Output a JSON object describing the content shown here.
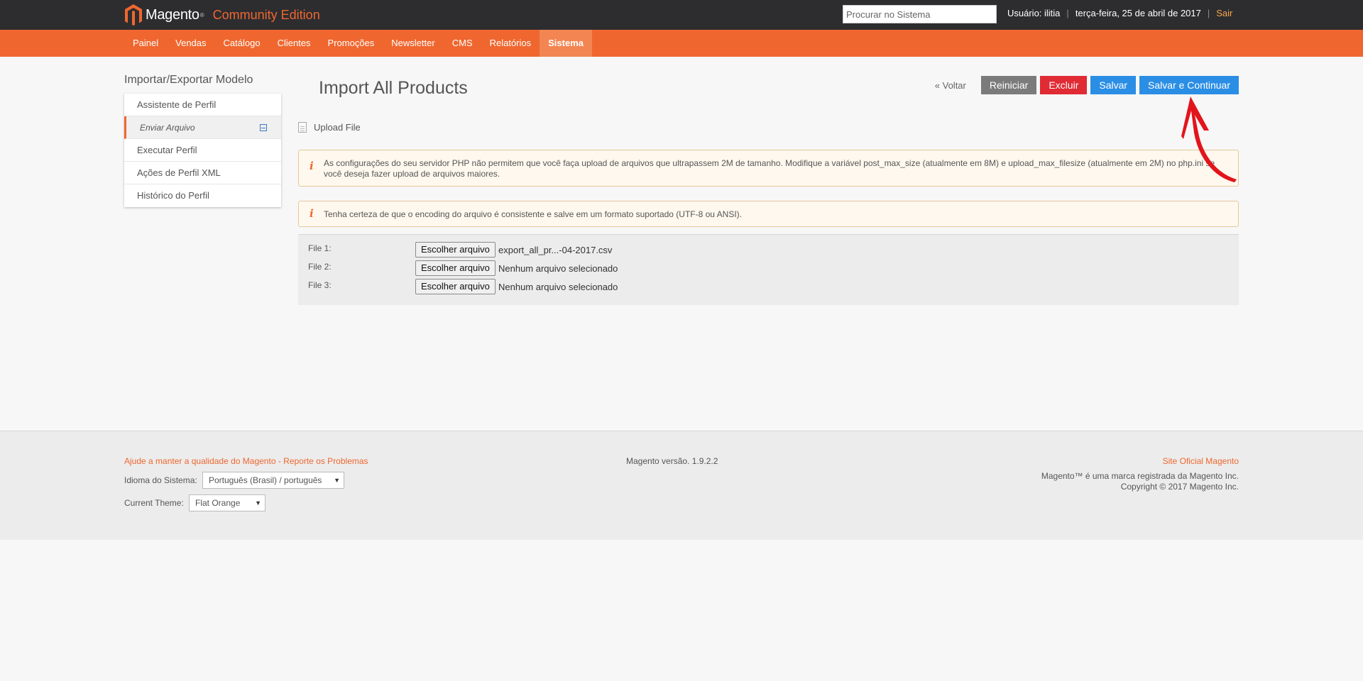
{
  "header": {
    "brand": "Magento",
    "brand_tm": "®",
    "edition": "Community Edition",
    "search_placeholder": "Procurar no Sistema",
    "user_label": "Usuário: ilitia",
    "date": "terça-feira, 25 de abril de 2017",
    "logout": "Sair"
  },
  "nav": {
    "items": [
      "Painel",
      "Vendas",
      "Catálogo",
      "Clientes",
      "Promoções",
      "Newsletter",
      "CMS",
      "Relatórios",
      "Sistema"
    ],
    "active": "Sistema"
  },
  "sidebar": {
    "title": "Importar/Exportar Modelo",
    "items": [
      {
        "label": "Assistente de Perfil"
      },
      {
        "label": "Enviar Arquivo",
        "active": true
      },
      {
        "label": "Executar Perfil"
      },
      {
        "label": "Ações de Perfil XML"
      },
      {
        "label": "Histórico do Perfil"
      }
    ]
  },
  "main": {
    "title": "Import All Products",
    "actions": {
      "back": "« Voltar",
      "reset": "Reiniciar",
      "delete": "Excluir",
      "save": "Salvar",
      "save_continue": "Salvar e Continuar"
    },
    "section_title": "Upload File",
    "notice_php": "As configurações do seu servidor PHP não permitem que você faça upload de arquivos que ultrapassem 2M de tamanho. Modifique a variável post_max_size (atualmente em 8M) e upload_max_filesize (atualmente em 2M) no php.ini se você deseja fazer upload de arquivos maiores.",
    "notice_encoding": "Tenha certeza de que o encoding do arquivo é consistente e salve em um formato suportado (UTF-8 ou ANSI).",
    "files": [
      {
        "label": "File 1:",
        "button": "Escolher arquivo",
        "value": "export_all_pr...-04-2017.csv"
      },
      {
        "label": "File 2:",
        "button": "Escolher arquivo",
        "value": "Nenhum arquivo selecionado"
      },
      {
        "label": "File 3:",
        "button": "Escolher arquivo",
        "value": "Nenhum arquivo selecionado"
      }
    ]
  },
  "footer": {
    "help_link": "Ajude a manter a qualidade do Magento - Reporte os Problemas",
    "version": "Magento versão. 1.9.2.2",
    "site_link": "Site Oficial Magento",
    "trademark": "Magento™ é uma marca registrada da Magento Inc.",
    "copyright": "Copyright © 2017 Magento Inc.",
    "language_label": "Idioma do Sistema:",
    "language_value": "Português (Brasil) / português",
    "theme_label": "Current Theme:",
    "theme_value": "Flat Orange"
  },
  "colors": {
    "header_bg": "#2d2d30",
    "accent_orange": "#ef672f",
    "button_gray": "#7b7b7b",
    "button_red": "#e02a34",
    "button_blue": "#2b8ee5",
    "annotation_arrow": "#e3141b"
  }
}
